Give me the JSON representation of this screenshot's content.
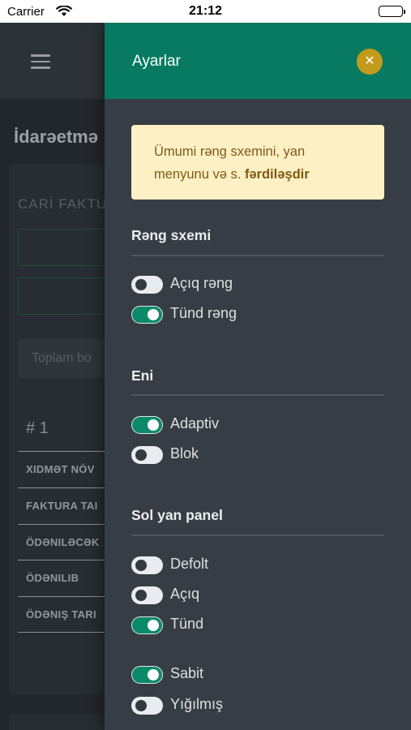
{
  "status_bar": {
    "carrier": "Carrier",
    "time": "21:12"
  },
  "background": {
    "page_title": "İdarəetmə",
    "card_label": "CARİ FAKTU",
    "total_placeholder": "Toplam bo",
    "item_number": "# 1",
    "rows": [
      "XIDMƏT NÖV",
      "FAKTURA TAI",
      "ÖDƏNILƏCƏK",
      "ÖDƏNILIB",
      "ÖDƏNIŞ TARI"
    ]
  },
  "drawer": {
    "title": "Ayarlar",
    "info_text": "Ümumi rəng sxemini, yan menyunu və s. ",
    "info_bold": "fərdiləşdir",
    "sections": {
      "color_scheme": {
        "title": "Rəng sxemi",
        "options": [
          {
            "label": "Açıq rəng",
            "enabled": false
          },
          {
            "label": "Tünd rəng",
            "enabled": true
          }
        ]
      },
      "width": {
        "title": "Eni",
        "options": [
          {
            "label": "Adaptiv",
            "enabled": true
          },
          {
            "label": "Blok",
            "enabled": false
          }
        ]
      },
      "sidebar": {
        "title": "Sol yan panel",
        "options": [
          {
            "label": "Defolt",
            "enabled": false
          },
          {
            "label": "Açıq",
            "enabled": false
          },
          {
            "label": "Tünd",
            "enabled": true
          },
          {
            "label": "Sabit",
            "enabled": true
          },
          {
            "label": "Yığılmış",
            "enabled": false
          }
        ]
      }
    }
  },
  "colors": {
    "header_green": "#077a61",
    "close_gold": "#c49a1a",
    "toggle_on": "#0b8a6a",
    "info_bg": "#fdf0c4"
  }
}
